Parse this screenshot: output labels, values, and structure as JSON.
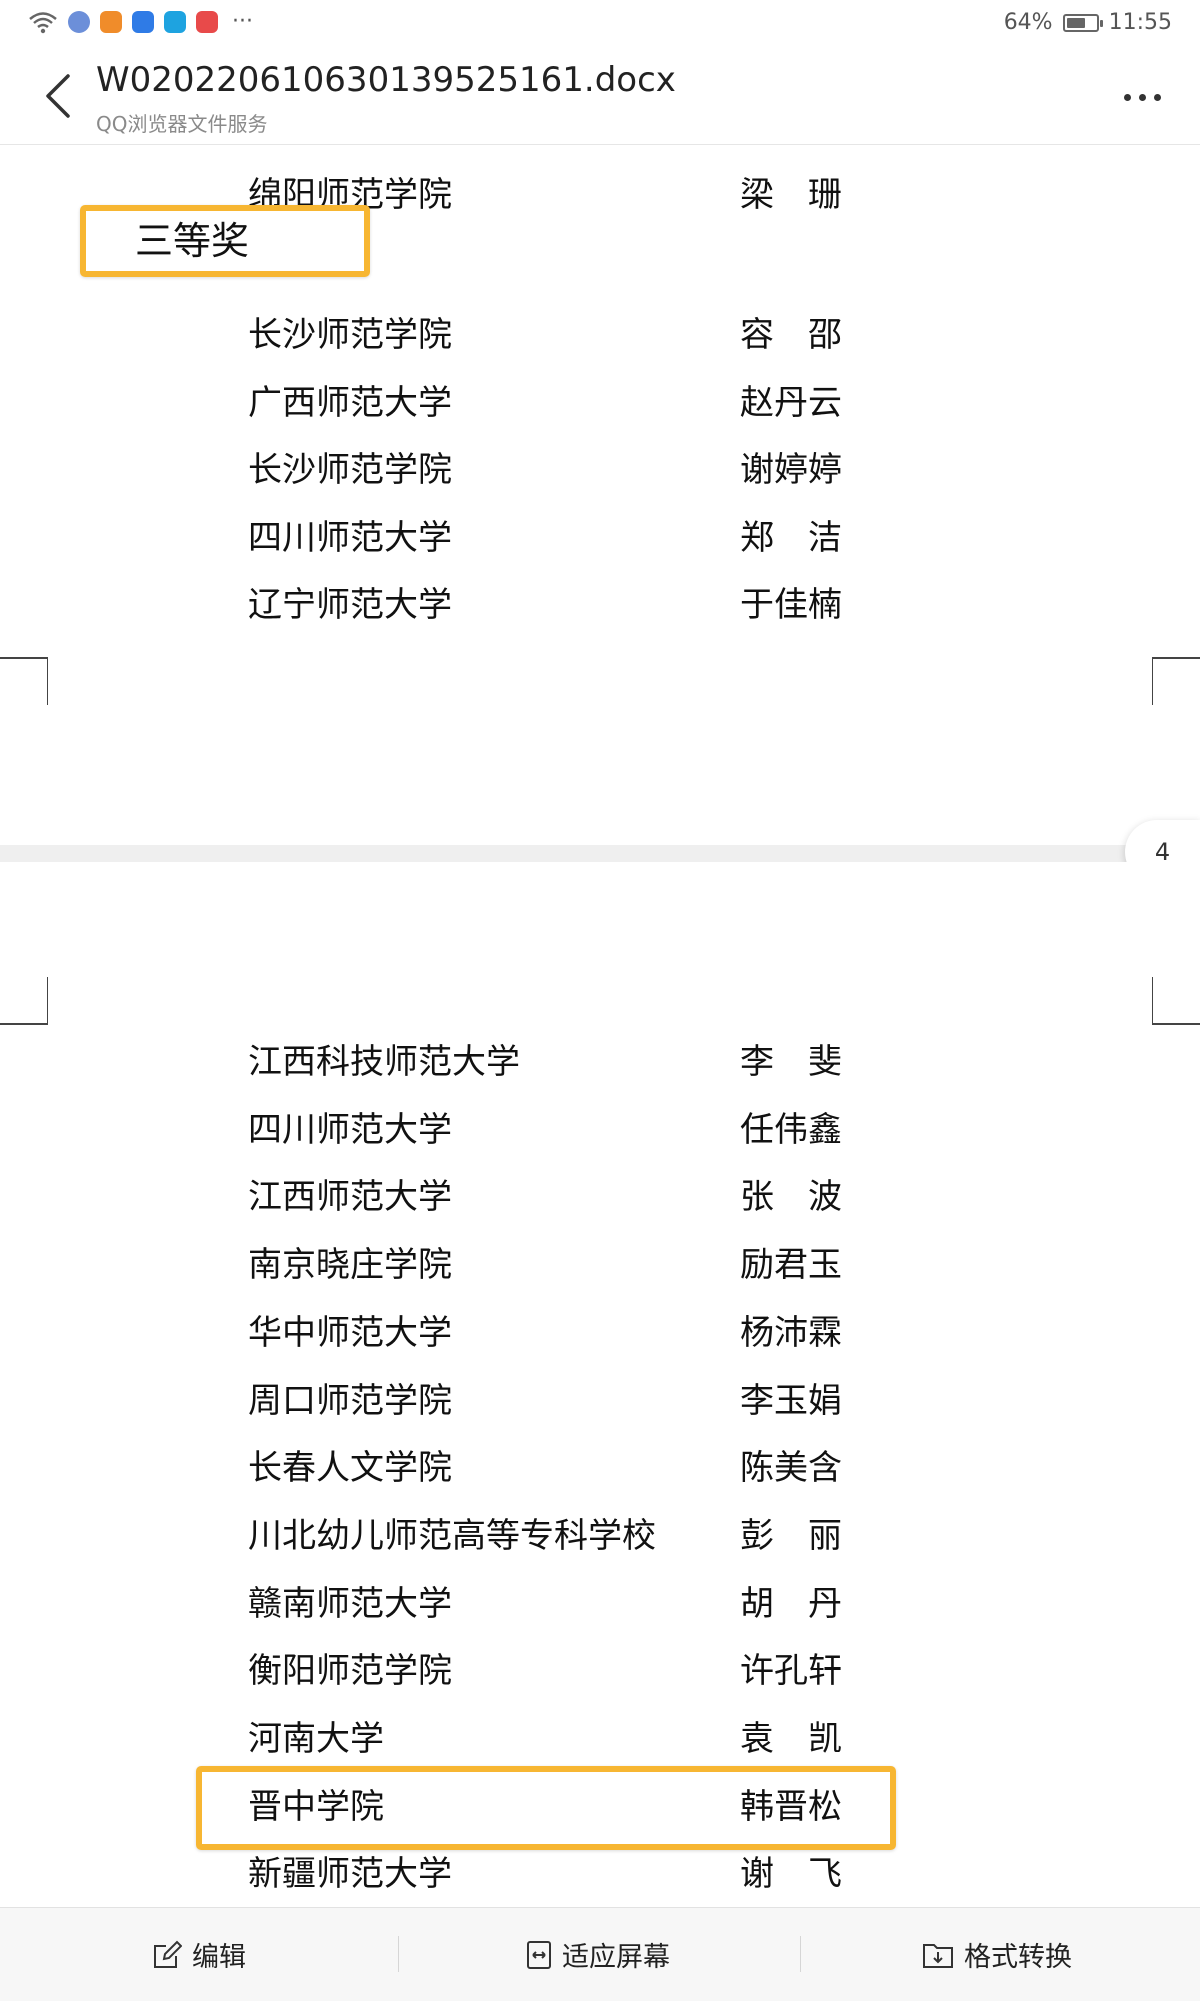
{
  "status": {
    "battery_text": "64%",
    "battery_level": 0.64,
    "time": "11:55"
  },
  "header": {
    "file_name": "W020220610630139525161.docx",
    "service": "QQ浏览器文件服务"
  },
  "document": {
    "page_a_first_row": {
      "unit": "绵阳师范学院",
      "name": "梁　珊"
    },
    "section_heading": "三等奖",
    "page_a_rows": [
      {
        "unit": "长沙师范学院",
        "name": "容　邵"
      },
      {
        "unit": "广西师范大学",
        "name": "赵丹云"
      },
      {
        "unit": "长沙师范学院",
        "name": "谢婷婷"
      },
      {
        "unit": "四川师范大学",
        "name": "郑　洁"
      },
      {
        "unit": "辽宁师范大学",
        "name": "于佳楠"
      }
    ],
    "page_indicator": "4",
    "page_b_rows": [
      {
        "unit": "江西科技师范大学",
        "name": "李　斐"
      },
      {
        "unit": "四川师范大学",
        "name": "任伟鑫"
      },
      {
        "unit": "江西师范大学",
        "name": "张　波"
      },
      {
        "unit": "南京晓庄学院",
        "name": "励君玉"
      },
      {
        "unit": "华中师范大学",
        "name": "杨沛霖"
      },
      {
        "unit": "周口师范学院",
        "name": "李玉娟"
      },
      {
        "unit": "长春人文学院",
        "name": "陈美含"
      },
      {
        "unit": "川北幼儿师范高等专科学校",
        "name": "彭　丽"
      },
      {
        "unit": "赣南师范大学",
        "name": "胡　丹"
      },
      {
        "unit": "衡阳师范学院",
        "name": "许孔轩"
      },
      {
        "unit": "河南大学",
        "name": "袁　凯"
      },
      {
        "unit": "晋中学院",
        "name": "韩晋松"
      },
      {
        "unit": "新疆师范大学",
        "name": "谢　飞"
      }
    ]
  },
  "toolbar": {
    "edit_label": "编辑",
    "fit_label": "适应屏幕",
    "convert_label": "格式转换"
  },
  "colors": {
    "highlight": "#f7b632",
    "divider": "#efefef"
  }
}
